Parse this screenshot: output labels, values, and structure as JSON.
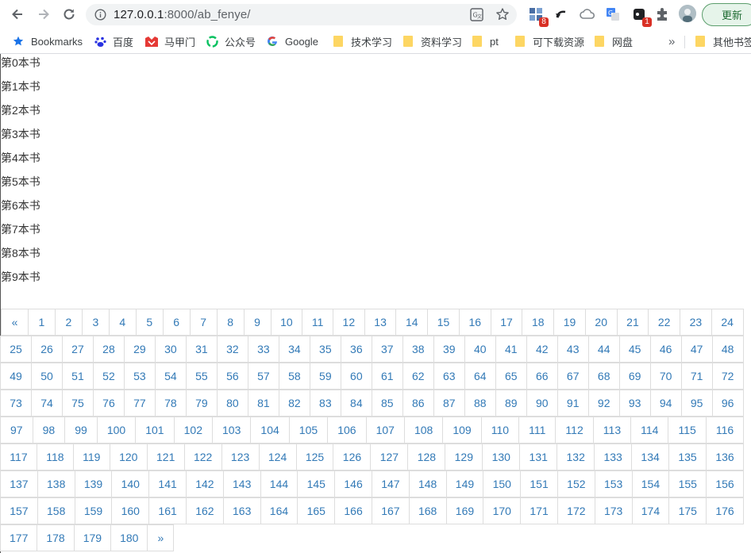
{
  "browser": {
    "url_host": "127.0.0.1",
    "url_rest": ":8000/ab_fenye/",
    "ext_badge_1": "8",
    "ext_badge_2": "1",
    "update_label": "更新"
  },
  "bookmarks": {
    "items": [
      {
        "label": "Bookmarks",
        "icon": "star-icon"
      },
      {
        "label": "百度",
        "icon": "baidu-icon"
      },
      {
        "label": "马甲门",
        "icon": "majiamen-icon"
      },
      {
        "label": "公众号",
        "icon": "wechat-icon"
      },
      {
        "label": "Google",
        "icon": "google-icon"
      },
      {
        "label": "技术学习",
        "icon": "folder-icon"
      },
      {
        "label": "资料学习",
        "icon": "folder-icon"
      },
      {
        "label": "pt",
        "icon": "folder-icon"
      },
      {
        "label": "可下载资源",
        "icon": "folder-icon"
      },
      {
        "label": "网盘",
        "icon": "folder-icon"
      },
      {
        "label": "其他书签",
        "icon": "folder-icon"
      }
    ],
    "overflow": "»"
  },
  "books": [
    "第0本书",
    "第1本书",
    "第2本书",
    "第3本书",
    "第4本书",
    "第5本书",
    "第6本书",
    "第7本书",
    "第8本书",
    "第9本书"
  ],
  "pagination": {
    "prev": "«",
    "next": "»",
    "first_page": 1,
    "last_page": 180
  },
  "colors": {
    "link": "#337ab7",
    "border": "#dddddd"
  }
}
